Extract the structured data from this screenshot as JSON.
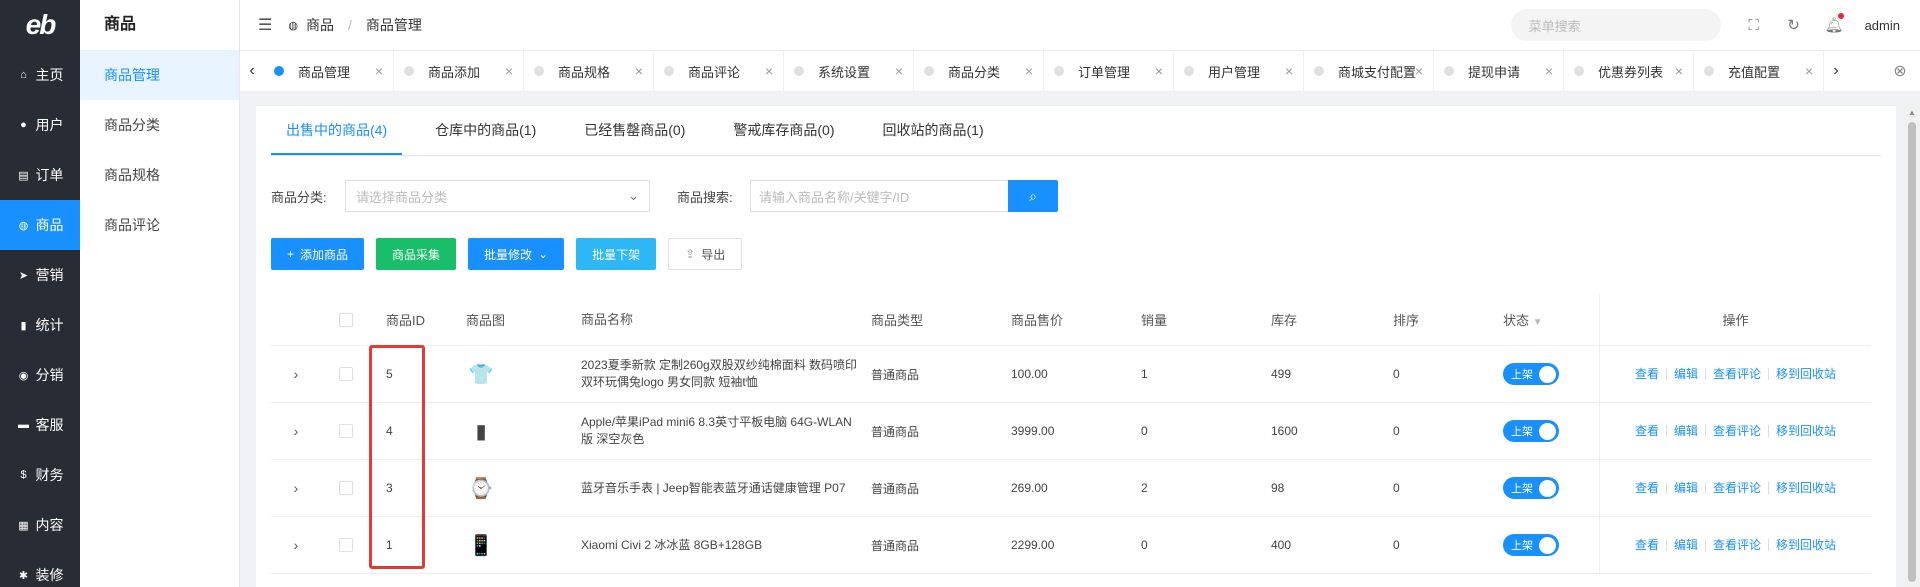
{
  "logo": "eb",
  "sidebar": {
    "items": [
      {
        "icon": "home-icon",
        "glyph": "⌂",
        "label": "主页"
      },
      {
        "icon": "user-icon",
        "glyph": "●",
        "label": "用户"
      },
      {
        "icon": "cart-icon",
        "glyph": "▤",
        "label": "订单"
      },
      {
        "icon": "bag-icon",
        "glyph": "◍",
        "label": "商品",
        "active": true
      },
      {
        "icon": "send-icon",
        "glyph": "➤",
        "label": "营销"
      },
      {
        "icon": "bar-chart-icon",
        "glyph": "▮",
        "label": "统计"
      },
      {
        "icon": "group-icon",
        "glyph": "◉",
        "label": "分销"
      },
      {
        "icon": "chat-icon",
        "glyph": "▬",
        "label": "客服"
      },
      {
        "icon": "dollar-icon",
        "glyph": "$",
        "label": "财务"
      },
      {
        "icon": "book-icon",
        "glyph": "▦",
        "label": "内容"
      },
      {
        "icon": "tools-icon",
        "glyph": "✱",
        "label": "装修"
      }
    ]
  },
  "subnav": {
    "title": "商品",
    "items": [
      "商品管理",
      "商品分类",
      "商品规格",
      "商品评论"
    ]
  },
  "header": {
    "breadcrumb": [
      "商品",
      "商品管理"
    ],
    "search_placeholder": "菜单搜索",
    "user": "admin"
  },
  "tabs": [
    "商品管理",
    "商品添加",
    "商品规格",
    "商品评论",
    "系统设置",
    "商品分类",
    "订单管理",
    "用户管理",
    "商城支付配置",
    "提现申请",
    "优惠券列表",
    "充值配置"
  ],
  "product_tabs": [
    "出售中的商品(4)",
    "仓库中的商品(1)",
    "已经售罄商品(0)",
    "警戒库存商品(0)",
    "回收站的商品(1)"
  ],
  "filter": {
    "category_label": "商品分类:",
    "category_placeholder": "请选择商品分类",
    "search_label": "商品搜索:",
    "search_placeholder": "请输入商品名称/关键字/ID"
  },
  "actions": {
    "add": "添加商品",
    "collect": "商品采集",
    "batch_edit": "批量修改",
    "batch_off": "批量下架",
    "export": "导出"
  },
  "table": {
    "headers": {
      "id": "商品ID",
      "img": "商品图",
      "name": "商品名称",
      "type": "商品类型",
      "price": "商品售价",
      "sales": "销量",
      "stock": "库存",
      "sort": "排序",
      "status": "状态",
      "ops": "操作"
    },
    "rows": [
      {
        "id": "5",
        "thumb": "👕",
        "name": "2023夏季新款 定制260g双股双纱纯棉面料 数码喷印双环玩偶兔logo 男女同款 短袖t恤",
        "type": "普通商品",
        "price": "100.00",
        "sales": "1",
        "stock": "499",
        "sort": "0",
        "status": "上架"
      },
      {
        "id": "4",
        "thumb": "▮",
        "name": "Apple/苹果iPad mini6 8.3英寸平板电脑 64G-WLAN版 深空灰色",
        "type": "普通商品",
        "price": "3999.00",
        "sales": "0",
        "stock": "1600",
        "sort": "0",
        "status": "上架"
      },
      {
        "id": "3",
        "thumb": "⌚",
        "name": "蓝牙音乐手表 | Jeep智能表蓝牙通话健康管理 P07",
        "type": "普通商品",
        "price": "269.00",
        "sales": "2",
        "stock": "98",
        "sort": "0",
        "status": "上架"
      },
      {
        "id": "1",
        "thumb": "📱",
        "name": "Xiaomi Civi 2 冰冰蓝 8GB+128GB",
        "type": "普通商品",
        "price": "2299.00",
        "sales": "0",
        "stock": "400",
        "sort": "0",
        "status": "上架"
      }
    ],
    "ops": [
      "查看",
      "编辑",
      "查看评论",
      "移到回收站"
    ]
  }
}
